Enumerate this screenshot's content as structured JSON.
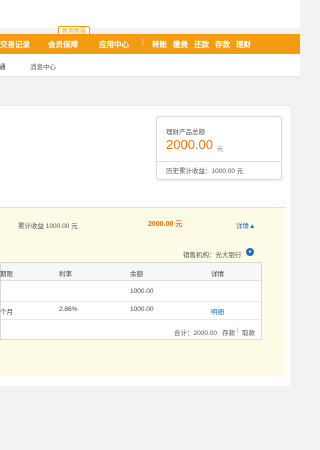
{
  "badge": "新用新服",
  "nav": {
    "items": [
      "交易记录",
      "会员保障",
      "应用中心",
      "转账",
      "缴费",
      "还款",
      "存款",
      "理财"
    ],
    "separator": "|"
  },
  "subnav": {
    "items": [
      "通",
      "消息中心"
    ]
  },
  "summary": {
    "total_label": "理财产品总额",
    "total_amount": "2000.00",
    "total_unit": "元",
    "history_label": "历史累计收益：1000.00 元"
  },
  "product": {
    "cumulative": "累计收益 1000.00 元",
    "amount": "2000.00 元",
    "detail_label": "详情▲"
  },
  "sale_org": "销售机构：光大银行",
  "table": {
    "headers": [
      "期限",
      "利率",
      "余额",
      "详情"
    ],
    "rows": [
      [
        "",
        "",
        "1000.00",
        ""
      ],
      [
        "个月",
        "2.86%",
        "1000.00",
        "明细"
      ]
    ],
    "footer_total": "合计：2000.00",
    "action_deposit": "存款",
    "action_sep": "|",
    "action_withdraw": "取款"
  },
  "colors": {
    "brand_orange": "#f39c12",
    "amount_orange": "#e8730c",
    "link_blue": "#1f6fbf",
    "notice_yellow": "#fdfae6"
  },
  "icons": [
    "bank-logo-icon"
  ]
}
